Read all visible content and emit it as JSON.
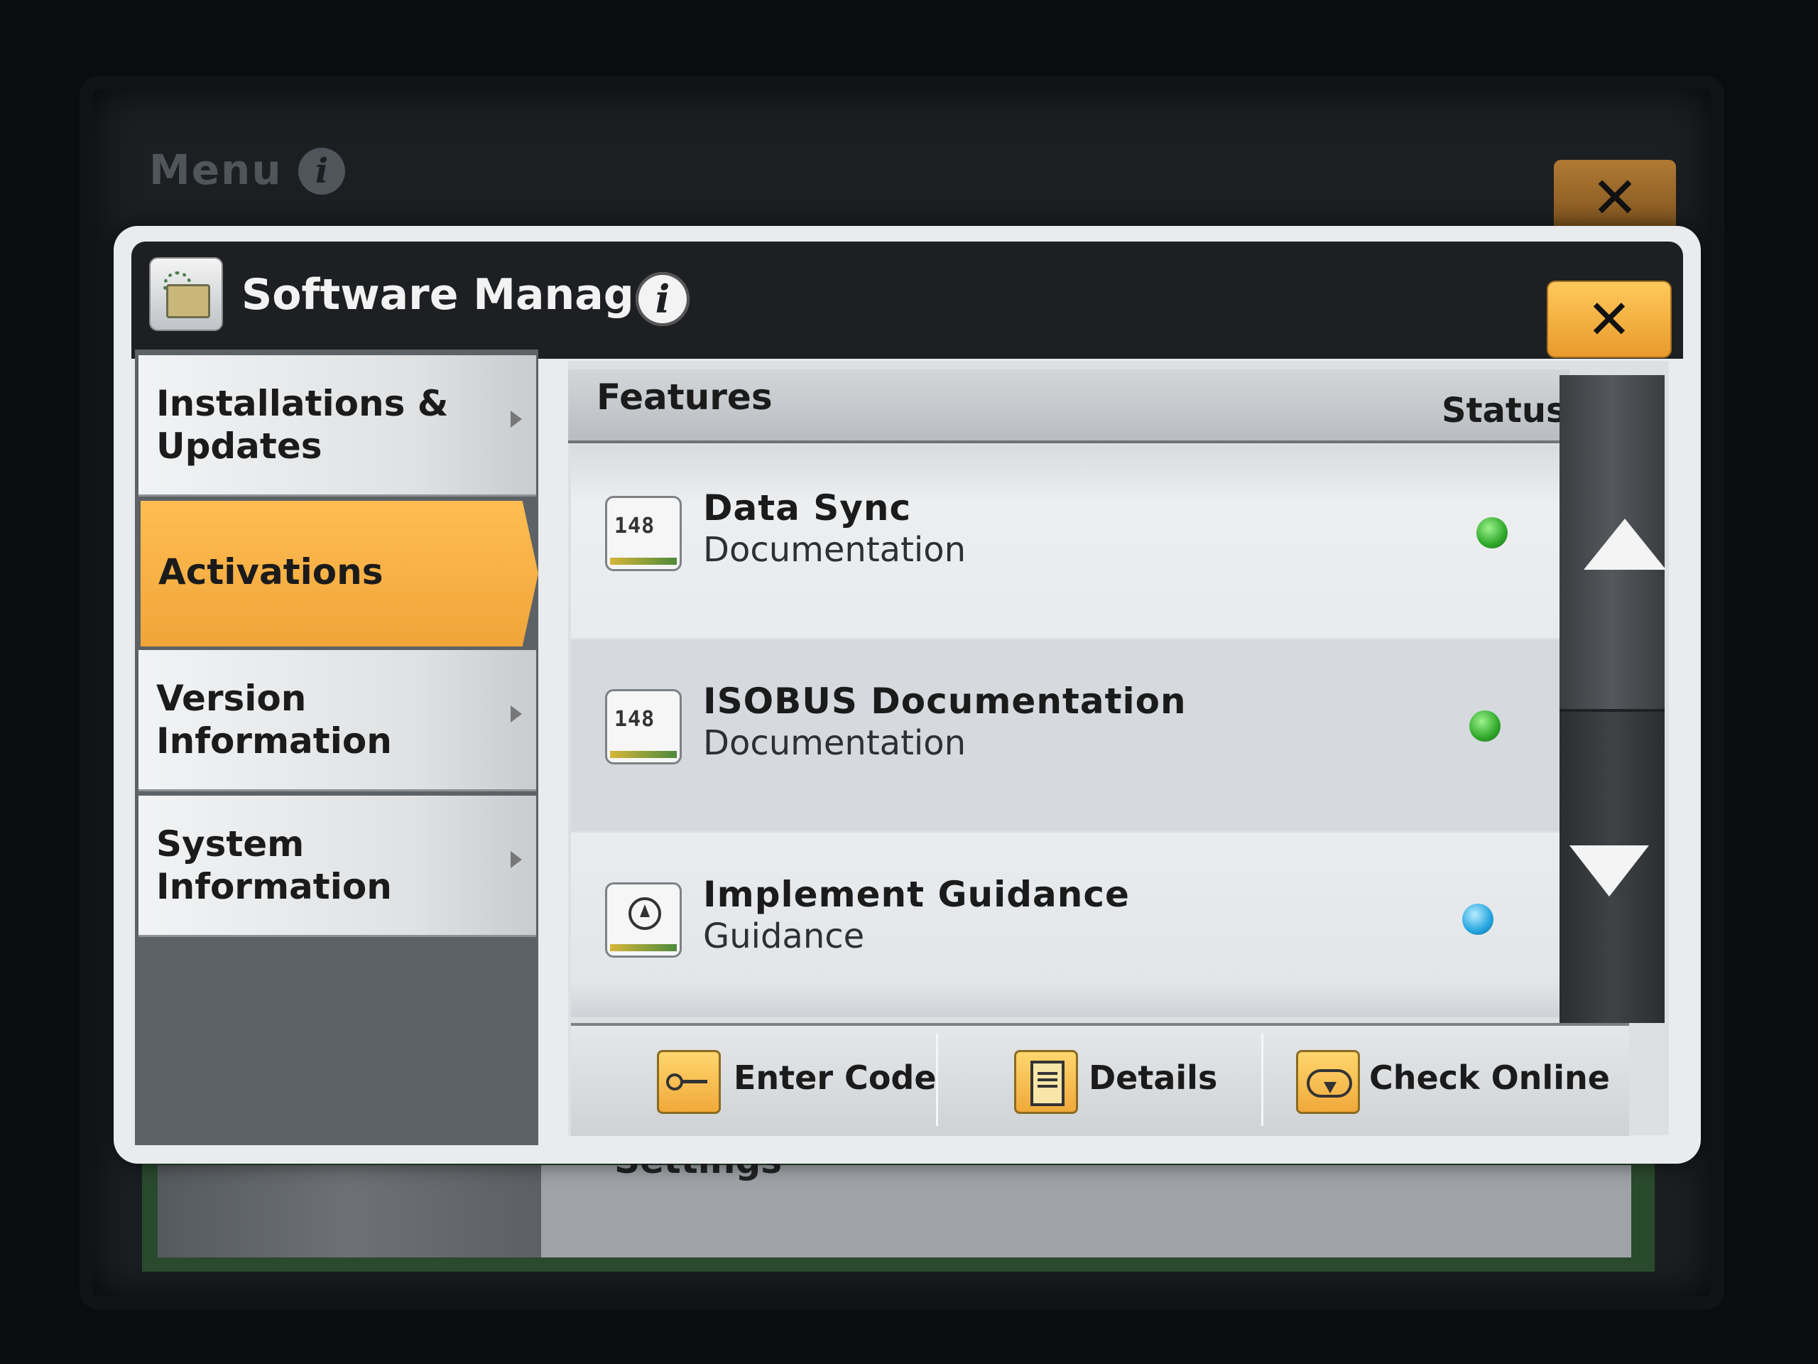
{
  "background_menu": {
    "title": "Menu",
    "partial_item": "Settings"
  },
  "modal": {
    "title": "Software Manager"
  },
  "sidebar": {
    "items": [
      {
        "label": "Installations & Updates",
        "selected": false
      },
      {
        "label": "Activations",
        "selected": true
      },
      {
        "label": "Version Information",
        "selected": false
      },
      {
        "label": "System Information",
        "selected": false
      }
    ]
  },
  "features": {
    "header": "Features",
    "status_header": "Status",
    "rows": [
      {
        "name": "Data Sync",
        "type": "Documentation",
        "icon": "documentation-icon",
        "icon_text": "148",
        "status_color": "#2fa82a"
      },
      {
        "name": "ISOBUS Documentation",
        "type": "Documentation",
        "icon": "documentation-icon",
        "icon_text": "148",
        "status_color": "#2fa82a"
      },
      {
        "name": "Implement Guidance",
        "type": "Guidance",
        "icon": "guidance-icon",
        "status_color": "#24a5e0"
      }
    ]
  },
  "toolbar": {
    "enter_code_label": "Enter Code",
    "details_label": "Details",
    "check_online_label": "Check Online"
  },
  "colors": {
    "accent": "#f0a53a",
    "header_dark": "#1d1f22",
    "status_green": "#2fa82a",
    "status_blue": "#24a5e0"
  }
}
